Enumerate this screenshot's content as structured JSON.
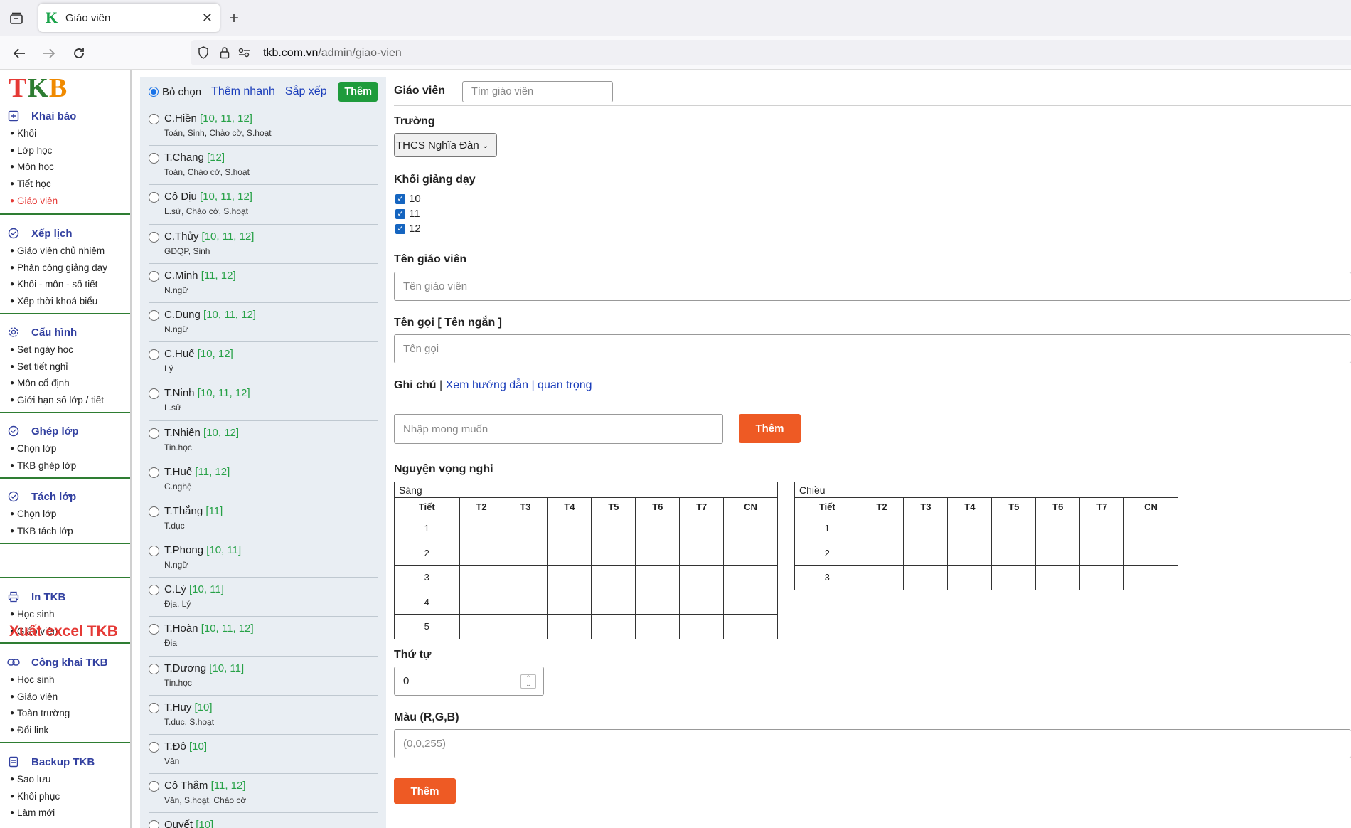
{
  "browser": {
    "tab_title": "Giáo viên",
    "url_domain": "tkb.com.vn",
    "url_path": "/admin/giao-vien"
  },
  "sidebar": {
    "logo": {
      "t": "T",
      "k": "K",
      "b": "B"
    },
    "sections": [
      {
        "title": "Khai báo",
        "icon": "plus-square-icon",
        "items": [
          "Khối",
          "Lớp học",
          "Môn học",
          "Tiết học",
          "Giáo viên"
        ],
        "active": 4
      },
      {
        "title": "Xếp lịch",
        "icon": "check-circle-icon",
        "items": [
          "Giáo viên chủ nhiệm",
          "Phân công giảng dạy",
          "Khối - môn - số tiết",
          "Xếp thời khoá biểu"
        ]
      },
      {
        "title": "Cấu hình",
        "icon": "gear-icon",
        "items": [
          "Set ngày học",
          "Set tiết nghỉ",
          "Môn cố định",
          "Giới hạn số lớp / tiết"
        ]
      },
      {
        "title": "Ghép lớp",
        "icon": "check-circle-icon",
        "items": [
          "Chọn lớp",
          "TKB ghép lớp"
        ]
      },
      {
        "title": "Tách lớp",
        "icon": "check-circle-icon",
        "items": [
          "Chọn lớp",
          "TKB tách lớp"
        ]
      },
      {
        "title": "In TKB",
        "icon": "printer-icon",
        "items": [
          "Học sinh",
          "Giáo viên"
        ]
      },
      {
        "title": "Công khai TKB",
        "icon": "link-icon",
        "items": [
          "Học sinh",
          "Giáo viên",
          "Toàn trường",
          "Đổi link"
        ]
      },
      {
        "title": "Backup TKB",
        "icon": "backup-icon",
        "items": [
          "Sao lưu",
          "Khôi phục",
          "Làm mới"
        ]
      }
    ],
    "export_label": "Xuất excel TKB"
  },
  "list": {
    "deselect_label": "Bỏ chọn",
    "quick_add": "Thêm nhanh",
    "sort": "Sắp xếp",
    "add": "Thêm",
    "teachers": [
      {
        "name": "C.Hiền",
        "grades": "[10, 11, 12]",
        "subjects": "Toán, Sinh, Chào cờ, S.hoạt"
      },
      {
        "name": "T.Chang",
        "grades": "[12]",
        "subjects": "Toán, Chào cờ, S.hoạt"
      },
      {
        "name": "Cô Dịu",
        "grades": "[10, 11, 12]",
        "subjects": "L.sử, Chào cờ, S.hoạt"
      },
      {
        "name": "C.Thủy",
        "grades": "[10, 11, 12]",
        "subjects": "GDQP, Sinh"
      },
      {
        "name": "C.Minh",
        "grades": "[11, 12]",
        "subjects": "N.ngữ"
      },
      {
        "name": "C.Dung",
        "grades": "[10, 11, 12]",
        "subjects": "N.ngữ"
      },
      {
        "name": "C.Huế",
        "grades": "[10, 12]",
        "subjects": "Lý"
      },
      {
        "name": "T.Ninh",
        "grades": "[10, 11, 12]",
        "subjects": "L.sử"
      },
      {
        "name": "T.Nhiên",
        "grades": "[10, 12]",
        "subjects": "Tin.học"
      },
      {
        "name": "T.Huế",
        "grades": "[11, 12]",
        "subjects": "C.nghệ"
      },
      {
        "name": "T.Thắng",
        "grades": "[11]",
        "subjects": "T.dục"
      },
      {
        "name": "T.Phong",
        "grades": "[10, 11]",
        "subjects": "N.ngữ"
      },
      {
        "name": "C.Lý",
        "grades": "[10, 11]",
        "subjects": "Địa, Lý"
      },
      {
        "name": "T.Hoàn",
        "grades": "[10, 11, 12]",
        "subjects": "Địa"
      },
      {
        "name": "T.Dương",
        "grades": "[10, 11]",
        "subjects": "Tin.học"
      },
      {
        "name": "T.Huy",
        "grades": "[10]",
        "subjects": "T.dục, S.hoạt"
      },
      {
        "name": "T.Đô",
        "grades": "[10]",
        "subjects": "Văn"
      },
      {
        "name": "Cô Thắm",
        "grades": "[11, 12]",
        "subjects": "Văn, S.hoạt, Chào cờ"
      },
      {
        "name": "Quyết",
        "grades": "[10]",
        "subjects": ""
      }
    ]
  },
  "form": {
    "search_label": "Giáo viên",
    "search_placeholder": "Tìm giáo viên",
    "school_label": "Trường",
    "school_value": "THCS Nghĩa Đàn",
    "grades_label": "Khối giảng dạy",
    "grades": [
      "10",
      "11",
      "12"
    ],
    "name_label": "Tên giáo viên",
    "name_placeholder": "Tên giáo viên",
    "short_label": "Tên gọi [ Tên ngắn ]",
    "short_placeholder": "Tên gọi",
    "note_label": "Ghi chú",
    "note_sep1": " | ",
    "note_link": "Xem hướng dẫn",
    "note_sep2": " | ",
    "note_link2": "quan trọng",
    "wish_placeholder": "Nhập mong muốn",
    "wish_button": "Thêm",
    "off_label": "Nguyện vọng nghỉ",
    "morning_caption": "Sáng",
    "afternoon_caption": "Chiều",
    "day_headers": [
      "Tiết",
      "T2",
      "T3",
      "T4",
      "T5",
      "T6",
      "T7",
      "CN"
    ],
    "morning_periods": [
      "1",
      "2",
      "3",
      "4",
      "5"
    ],
    "afternoon_periods": [
      "1",
      "2",
      "3"
    ],
    "order_label": "Thứ tự",
    "order_value": "0",
    "color_label": "Màu (R,G,B)",
    "color_placeholder": "(0,0,255)",
    "submit": "Thêm"
  }
}
